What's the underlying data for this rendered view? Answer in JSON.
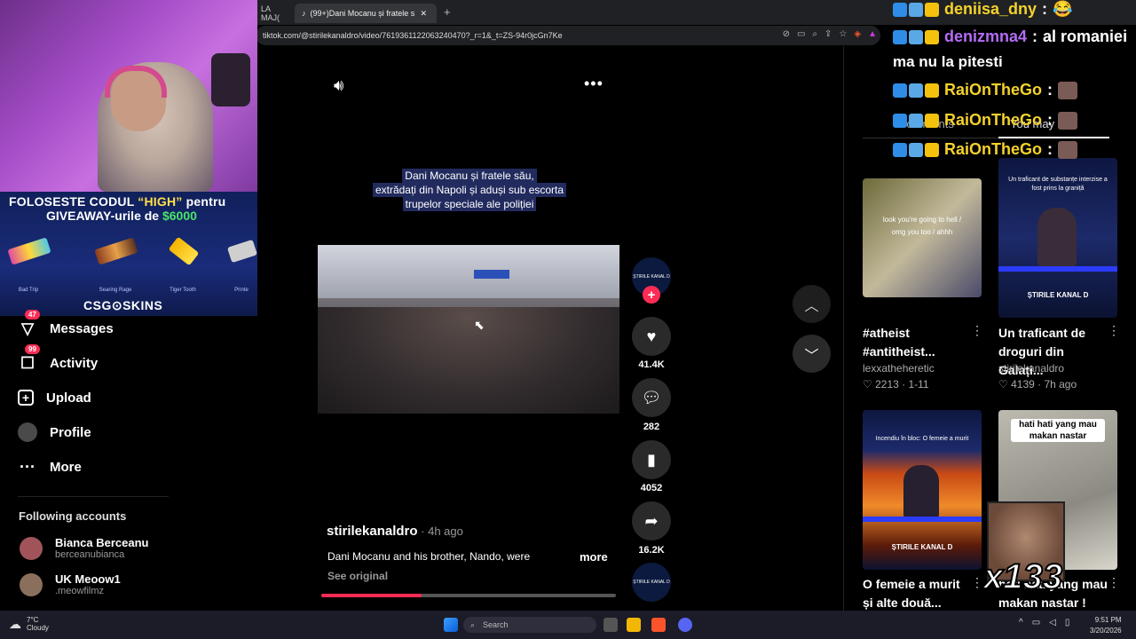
{
  "browser": {
    "prev_tab_label": "LA MAJ(",
    "active_tab_label": "(99+)Dani Mocanu și fratele s",
    "url": "tiktok.com/@stirilekanaldro/video/7619361122063240470?_r=1&_t=ZS-94r0jcGn7Ke",
    "new_tab_label": "+"
  },
  "promo": {
    "line1_prefix": "FOLOSESTE CODUL ",
    "line1_code": "“HIGH”",
    "line1_suffix": " pentru",
    "line2_prefix": "GIVEAWAY-urile de ",
    "line2_amount": "$6000",
    "skins": [
      "Bad Trip",
      "Searing Rage",
      "Tiger Tooth",
      "Printe"
    ],
    "brand": "CSG⊙SKINS"
  },
  "nav": {
    "messages_label": "Messages",
    "messages_badge": "47",
    "activity_label": "Activity",
    "activity_badge": "99",
    "upload_label": "Upload",
    "profile_label": "Profile",
    "more_label": "More"
  },
  "following": {
    "title": "Following accounts",
    "accounts": [
      {
        "name": "Bianca Berceanu",
        "handle": "berceanubianca"
      },
      {
        "name": "UK Meoow1",
        "handle": ".meowfilmz"
      }
    ]
  },
  "video": {
    "caption_line1": "Dani Mocanu și fratele său,",
    "caption_line2": "extrădați din Napoli și aduși sub escorta",
    "caption_line3": "trupelor speciale ale poliției",
    "author": "stirilekanaldro",
    "posted": " · 4h ago",
    "description": "Dani Mocanu and his brother, Nando, were",
    "more_label": "more",
    "see_original": "See original",
    "progress": 0.34,
    "avatar_text": "ȘTIRILE KANAL D",
    "like_count": "41.4K",
    "comment_count": "282",
    "save_count": "4052",
    "share_count": "16.2K"
  },
  "chat": {
    "messages": [
      {
        "user": "deniisa_dny",
        "sep": " :",
        "msg": "😂",
        "color": "#f4d22b"
      },
      {
        "user": "denizmna4",
        "sep": " :",
        "msg": "al romaniei",
        "color": "#b36cf4"
      },
      {
        "user": "RaiOnTheGo",
        "sep": " :",
        "msg": "",
        "color": "#f4d22b"
      },
      {
        "user": "RaiOnTheGo",
        "sep": " :",
        "msg": "",
        "color": "#f4d22b"
      },
      {
        "user": "RaiOnTheGo",
        "sep": " :",
        "msg": "",
        "color": "#f4d22b"
      }
    ],
    "free_line": "ma nu la pitesti",
    "combo": "x133"
  },
  "sidepanel": {
    "comments_tab": "Comments",
    "you_may_like_tab": "You may like",
    "videos": [
      {
        "title": "#atheist #antitheist...",
        "user": "lexxatheheretic",
        "meta": "♡ 2213 · 1-11",
        "thumb_text": "look you're going to hell / omg you too / ahhh"
      },
      {
        "title": "Un traficant de droguri din Galați...",
        "user": "stirilekanaldro",
        "meta": "♡ 4139 · 7h ago",
        "thumb_text": "Un traficant de substanțe interzise a fost prins la graniță",
        "logo": "ȘTIRILE KANAL D"
      },
      {
        "title": "O femeie a murit și alte două...",
        "user": "",
        "meta": "",
        "thumb_text": "Incendiu în bloc: O femeie a murit",
        "logo": "ȘTIRILE KANAL D"
      },
      {
        "title": "hati hati yang mau makan nastar !",
        "user": "",
        "meta": "",
        "thumb_text": "hati hati yang mau makan nastar"
      }
    ]
  },
  "taskbar": {
    "temp": "7°C",
    "weather": "Cloudy",
    "search": "Search",
    "time": "9:51 PM",
    "date": "3/20/2026"
  },
  "colors": {
    "accent": "#fe2c55",
    "chat_gold": "#f4d22b",
    "chat_purple": "#b36cf4"
  }
}
